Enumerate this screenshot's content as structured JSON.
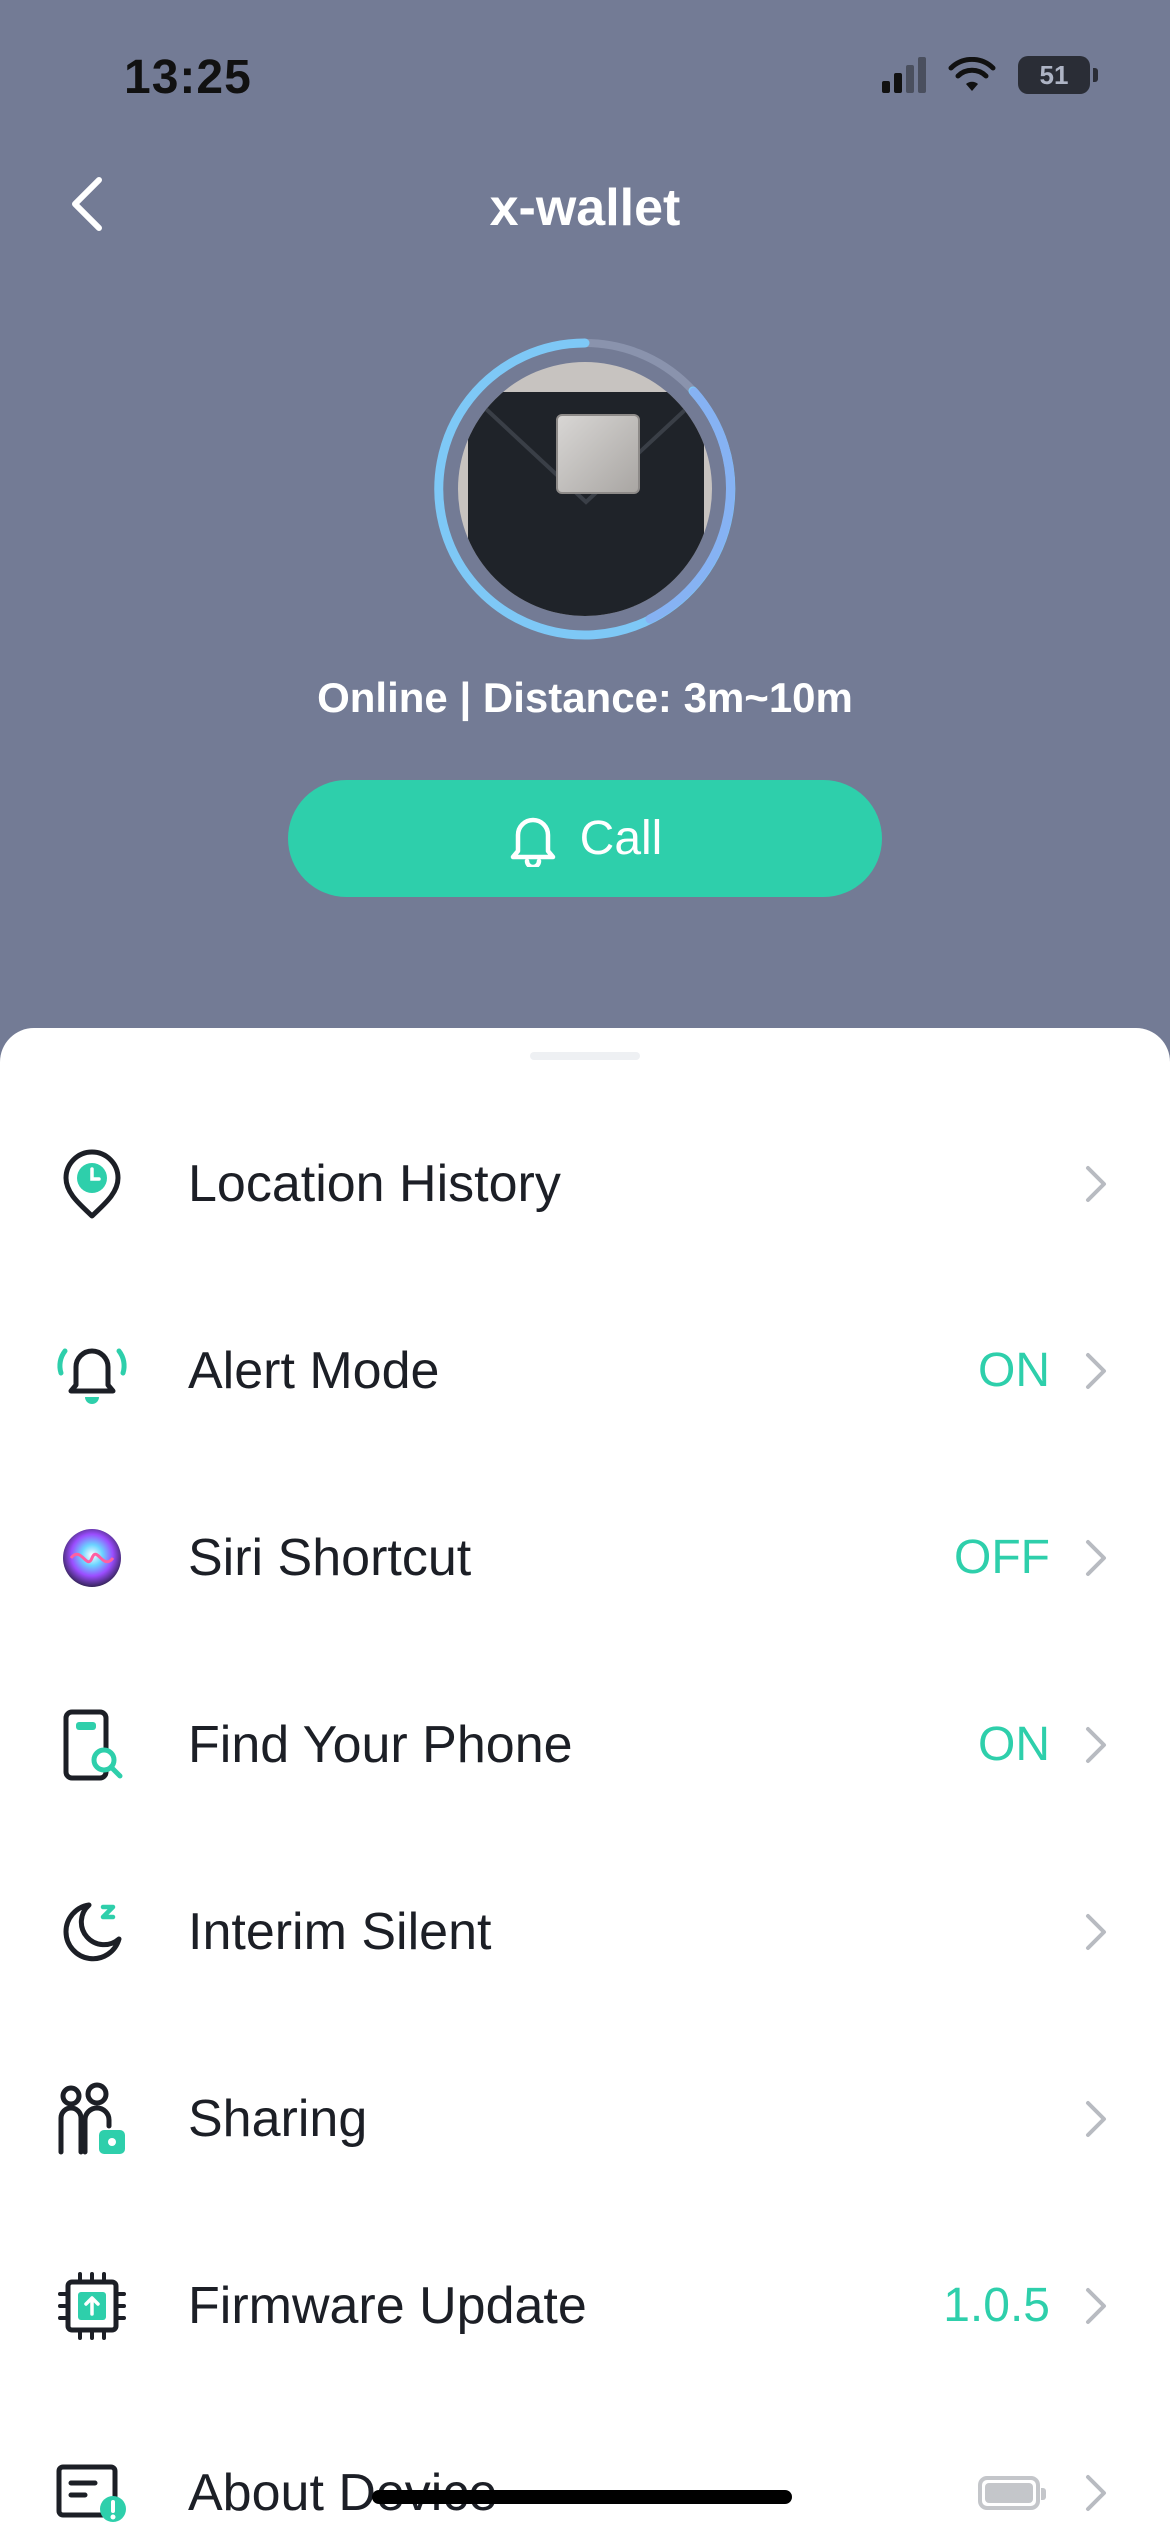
{
  "status_bar": {
    "time": "13:25",
    "battery": "51"
  },
  "header": {
    "title": "x-wallet"
  },
  "device": {
    "status_text": "Online | Distance: 3m~10m",
    "call_label": "Call"
  },
  "colors": {
    "accent": "#2ecfab",
    "header_bg": "#737b95",
    "text_dark": "#1c1f26"
  },
  "menu": [
    {
      "label": "Location History",
      "value": "",
      "icon": "location-clock-icon"
    },
    {
      "label": "Alert Mode",
      "value": "ON",
      "icon": "bell-ringing-icon"
    },
    {
      "label": "Siri Shortcut",
      "value": "OFF",
      "icon": "siri-icon"
    },
    {
      "label": "Find Your Phone",
      "value": "ON",
      "icon": "phone-search-icon"
    },
    {
      "label": "Interim Silent",
      "value": "",
      "icon": "moon-icon"
    },
    {
      "label": "Sharing",
      "value": "",
      "icon": "people-share-icon"
    },
    {
      "label": "Firmware Update",
      "value": "1.0.5",
      "icon": "chip-upload-icon"
    },
    {
      "label": "About Device",
      "value": "",
      "icon": "device-info-icon",
      "battery_level": 1.0
    }
  ]
}
